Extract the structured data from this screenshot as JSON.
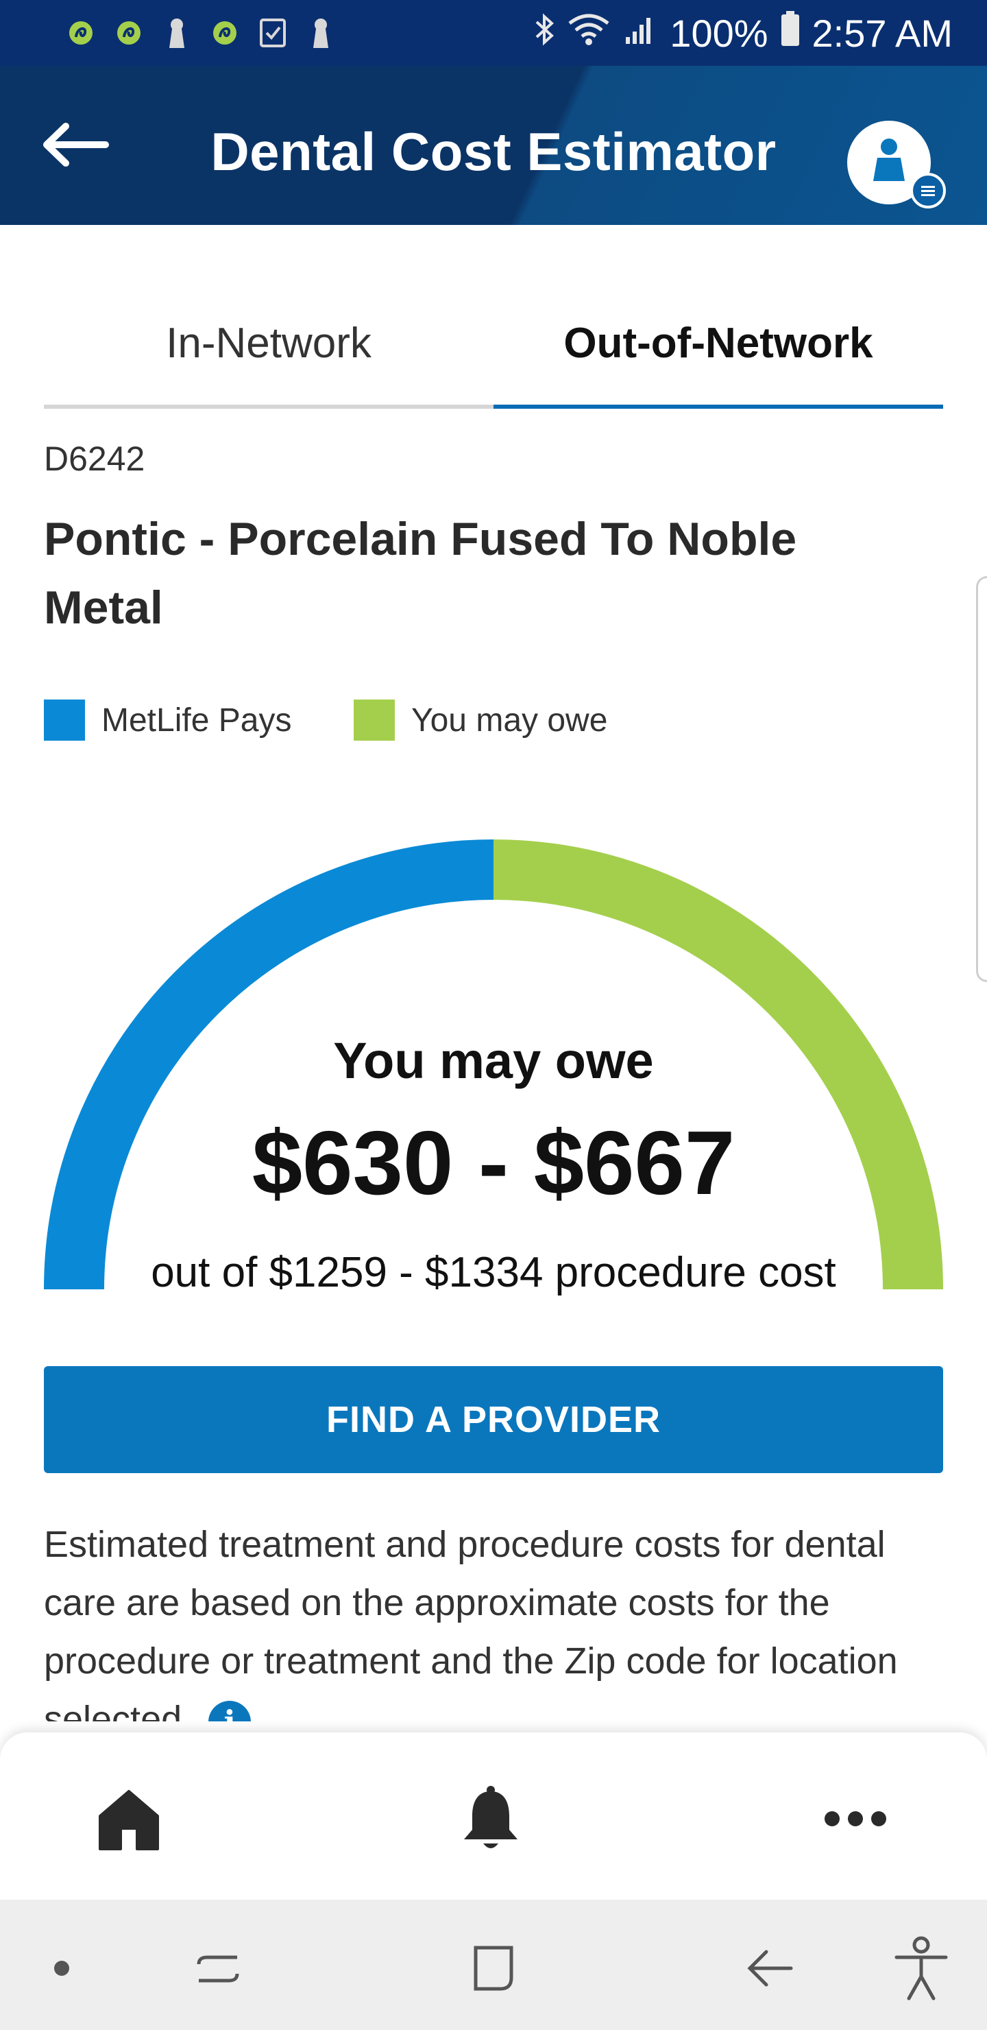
{
  "status_bar": {
    "battery": "100%",
    "time": "2:57 AM",
    "icons": [
      "app-notification-icon",
      "app-notification-icon",
      "lock-icon",
      "app-notification-icon",
      "checkbox-icon",
      "lock-icon",
      "bluetooth-icon",
      "wifi-icon",
      "signal-icon",
      "battery-icon"
    ]
  },
  "header": {
    "title": "Dental Cost Estimator"
  },
  "tabs": [
    {
      "label": "In-Network",
      "active": false
    },
    {
      "label": "Out-of-Network",
      "active": true
    }
  ],
  "procedure": {
    "code": "D6242",
    "name": "Pontic - Porcelain Fused To Noble Metal"
  },
  "legend": [
    {
      "label": "MetLife Pays",
      "color": "#0a8ad6"
    },
    {
      "label": "You may owe",
      "color": "#a4cf4c"
    }
  ],
  "gauge": {
    "label": "You may owe",
    "range": "$630 - $667",
    "subtitle": "out of $1259 - $1334 procedure cost",
    "metlife_share": 0.5,
    "owe_share": 0.5
  },
  "find_provider_label": "FIND A PROVIDER",
  "disclaimer": "Estimated treatment and procedure costs for dental care are based on the approximate costs for the procedure or treatment and the Zip code for location selected.",
  "info_glyph": "i",
  "bottom_nav": [
    {
      "icon": "home-icon"
    },
    {
      "icon": "bell-icon"
    },
    {
      "icon": "more-icon"
    }
  ],
  "colors": {
    "status_bar": "#0a2f70",
    "app_bar": "#0b3466",
    "primary": "#0a77bd",
    "metlife_blue": "#0a8ad6",
    "owe_green": "#a4cf4c"
  }
}
